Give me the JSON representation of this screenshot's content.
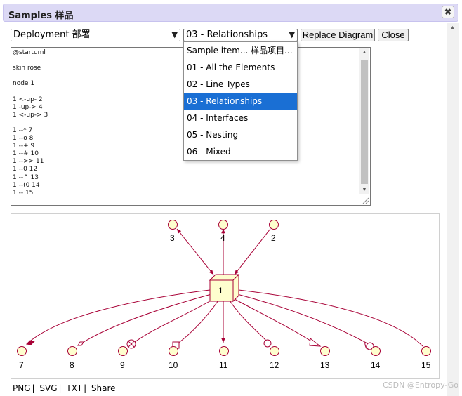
{
  "window": {
    "title": "Samples 样品",
    "close_label": "✖"
  },
  "toolbar": {
    "type_select_value": "Deployment 部署",
    "sample_select_value": "03 - Relationships",
    "replace_label": "Replace Diagram",
    "close_label": "Close"
  },
  "dropdown": {
    "options": [
      "Sample item... 样品项目...",
      "01 - All the Elements",
      "02 - Line Types",
      "03 - Relationships",
      "04 - Interfaces",
      "05 - Nesting",
      "06 - Mixed"
    ],
    "selected": "03 - Relationships"
  },
  "editor": {
    "text": "@startuml\n\nskin rose\n\nnode 1\n\n1 <-up- 2\n1 -up-> 4\n1 <-up-> 3\n\n1 --* 7\n1 --o 8\n1 --+ 9\n1 --# 10\n1 -->> 11\n1 --0 12\n1 --^ 13\n1 --(0 14\n1 -- 15"
  },
  "diagram": {
    "center_node": "1",
    "top_labels": [
      "3",
      "4",
      "2"
    ],
    "bottom_labels": [
      "7",
      "8",
      "9",
      "10",
      "11",
      "12",
      "13",
      "14",
      "15"
    ],
    "colors": {
      "line": "#a80036",
      "node_fill": "#fefece",
      "node_stroke": "#a80036",
      "circle_fill": "#fefece"
    }
  },
  "links": {
    "png": "PNG",
    "svg": "SVG",
    "txt": "TXT",
    "share": "Share"
  },
  "watermark": "CSDN @Entropy-Go"
}
